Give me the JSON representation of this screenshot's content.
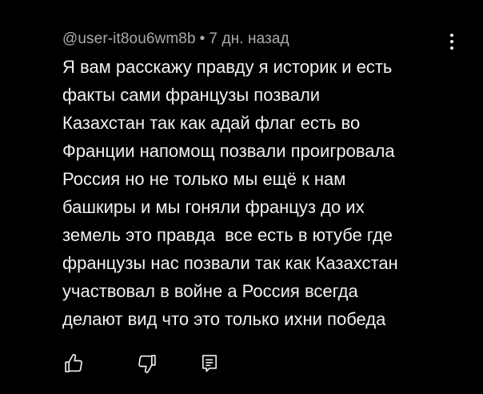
{
  "comment": {
    "author": "@user-it8ou6wm8b",
    "separator": "•",
    "time": "7 дн. назад",
    "lines": [
      "Я вам расскажу правду я историк и есть",
      "факты сами французы позвали",
      "Казахстан так как адай флаг есть во",
      "Франции напомощ позвали проигровала",
      "Россия но не только мы ещё к нам",
      "башкиры и мы гоняли француз до их",
      "земель это правда  все есть в ютубе где",
      "французы нас позвали так как Казахстан",
      "участвовал в войне а Россия всегда",
      "делают вид что это только ихни победа"
    ]
  },
  "actions": {
    "like_icon": "thumbs-up-icon",
    "dislike_icon": "thumbs-down-icon",
    "reply_icon": "reply-comment-icon",
    "more_icon": "more-vertical-icon"
  },
  "colors": {
    "background": "#000000",
    "text": "#f1f1f1",
    "meta": "#aaaaaa"
  }
}
